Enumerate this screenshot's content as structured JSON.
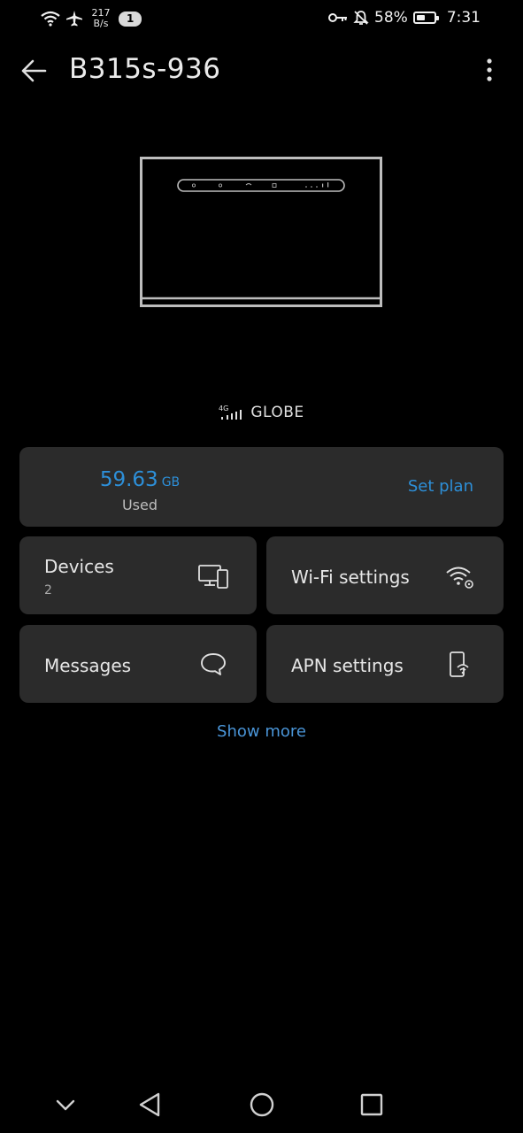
{
  "status_bar": {
    "speed_value": "217",
    "speed_unit": "B/s",
    "badge": "1",
    "battery": "58%",
    "time": "7:31",
    "icons": [
      "wifi-icon",
      "airplane-icon",
      "key-icon",
      "mute-icon",
      "battery-icon"
    ]
  },
  "header": {
    "title": "B315s-936",
    "back_icon": "arrow-left-icon",
    "more_icon": "more-vertical-icon"
  },
  "carrier": {
    "network": "4G",
    "name": "GLOBE"
  },
  "usage": {
    "value": "59.63",
    "unit": "GB",
    "label": "Used",
    "set_plan": "Set plan"
  },
  "tiles": {
    "devices": {
      "label": "Devices",
      "count": "2",
      "icon": "devices-icon"
    },
    "wifi": {
      "label": "Wi-Fi settings",
      "icon": "wifi-settings-icon"
    },
    "messages": {
      "label": "Messages",
      "icon": "message-bubble-icon"
    },
    "apn": {
      "label": "APN settings",
      "icon": "apn-phone-icon"
    }
  },
  "show_more": "Show more",
  "colors": {
    "background": "#000000",
    "card": "#2b2b2b",
    "accent": "#2d8fd8"
  }
}
